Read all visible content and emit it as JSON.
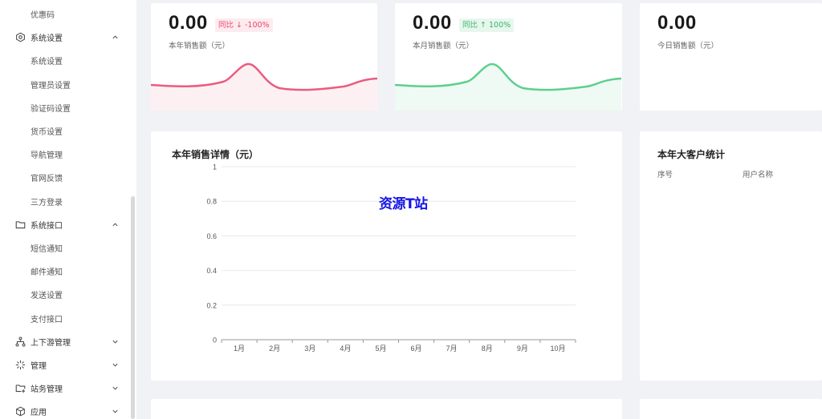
{
  "sidebar": {
    "items": [
      {
        "label": "优惠码",
        "type": "sub"
      },
      {
        "label": "系统设置",
        "type": "group",
        "icon": "hexagon-settings-icon",
        "arrow": "up"
      },
      {
        "label": "系统设置",
        "type": "sub"
      },
      {
        "label": "管理员设置",
        "type": "sub"
      },
      {
        "label": "验证码设置",
        "type": "sub"
      },
      {
        "label": "货币设置",
        "type": "sub"
      },
      {
        "label": "导航管理",
        "type": "sub"
      },
      {
        "label": "官网反馈",
        "type": "sub"
      },
      {
        "label": "三方登录",
        "type": "sub"
      },
      {
        "label": "系统接口",
        "type": "group",
        "icon": "folder-icon",
        "arrow": "up"
      },
      {
        "label": "短信通知",
        "type": "sub"
      },
      {
        "label": "邮件通知",
        "type": "sub"
      },
      {
        "label": "发送设置",
        "type": "sub"
      },
      {
        "label": "支付接口",
        "type": "sub"
      },
      {
        "label": "上下游管理",
        "type": "group",
        "icon": "network-icon",
        "arrow": "down"
      },
      {
        "label": "管理",
        "type": "group",
        "icon": "sparkle-icon",
        "arrow": "down"
      },
      {
        "label": "站务管理",
        "type": "group",
        "icon": "folder-add-icon",
        "arrow": "down"
      },
      {
        "label": "应用",
        "type": "group",
        "icon": "cube-icon",
        "arrow": "down"
      }
    ]
  },
  "stats": [
    {
      "value": "0.00",
      "badge": "同比 ↓ -100%",
      "label": "本年销售额（元）",
      "trend": "down",
      "color": "#ea5c80",
      "fill": "#fdf0f3"
    },
    {
      "value": "0.00",
      "badge": "同比 ↑ 100%",
      "label": "本月销售额（元）",
      "trend": "up",
      "color": "#5ecf8e",
      "fill": "#eefaf3"
    },
    {
      "value": "0.00",
      "badge": "",
      "label": "今日销售额（元）",
      "trend": "none"
    }
  ],
  "sales_panel": {
    "title": "本年销售详情（元）",
    "watermark": "资源T站"
  },
  "chart_data": {
    "type": "line",
    "title": "本年销售详情（元）",
    "categories": [
      "1月",
      "2月",
      "3月",
      "4月",
      "5月",
      "6月",
      "7月",
      "8月",
      "9月",
      "10月"
    ],
    "series": [
      {
        "values": [
          0,
          0,
          0,
          0,
          0,
          0,
          0,
          0,
          0,
          0
        ]
      }
    ],
    "y_ticks": [
      "0",
      "0.2",
      "0.4",
      "0.6",
      "0.8",
      "1"
    ],
    "ylim": [
      0,
      1
    ],
    "grid": true
  },
  "customer_panel": {
    "title": "本年大客户统计",
    "columns": [
      "序号",
      "用户名称"
    ]
  },
  "colors": {
    "down": "#e6476b",
    "up": "#36b56a",
    "background": "#f0f2f5"
  }
}
